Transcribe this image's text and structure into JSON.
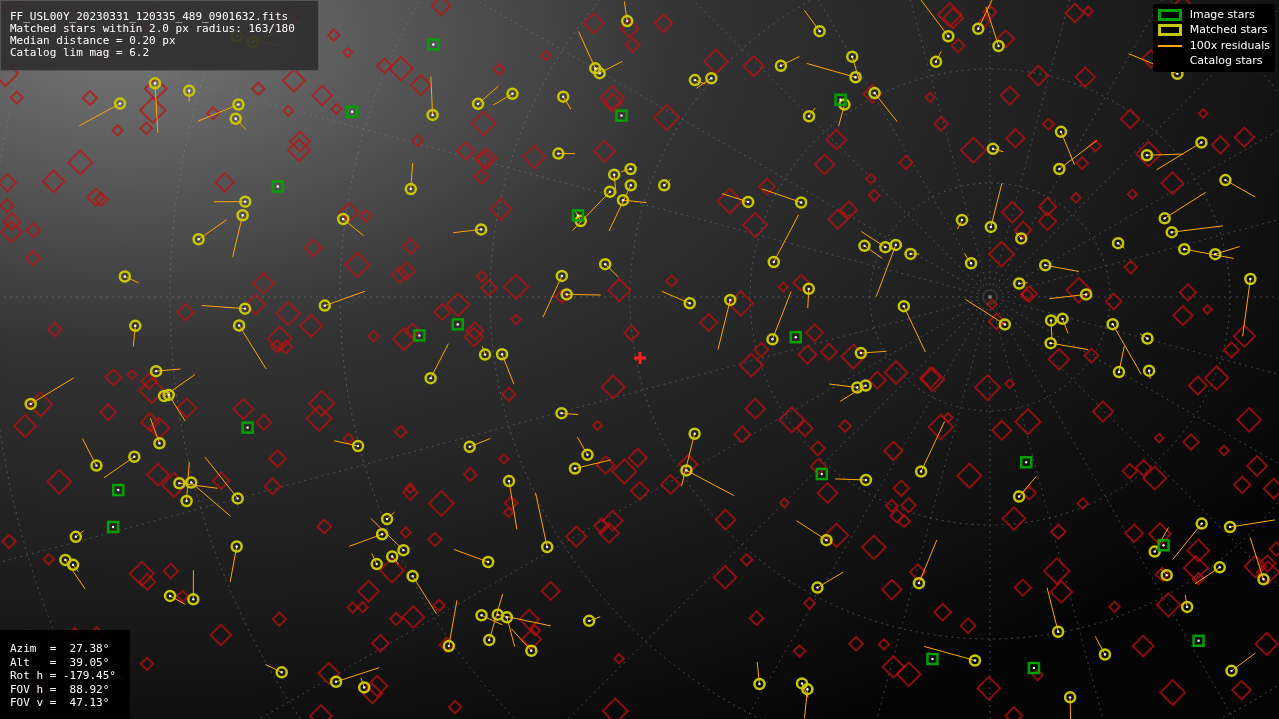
{
  "info_box": {
    "lines": [
      "FF_USL00Y_20230331_120335_489_0901632.fits",
      "Matched stars within 2.0 px radius: 163/180",
      "Median distance = 0.20 px",
      "Catalog lim mag = 6.2"
    ]
  },
  "legend": [
    {
      "label": "Image stars",
      "kind": "box",
      "color": "#00a000"
    },
    {
      "label": "Matched stars",
      "kind": "box",
      "color": "#c8c800"
    },
    {
      "label": "100x residuals",
      "kind": "line",
      "color": "#ffa500"
    },
    {
      "label": "Catalog stars",
      "kind": "plain"
    }
  ],
  "pointing_box": {
    "lines": [
      "Azim  =  27.38°",
      "Alt   =  39.05°",
      "Rot h = -179.45°",
      "FOV h =  88.92°",
      "FOV v =  47.13°"
    ]
  }
}
